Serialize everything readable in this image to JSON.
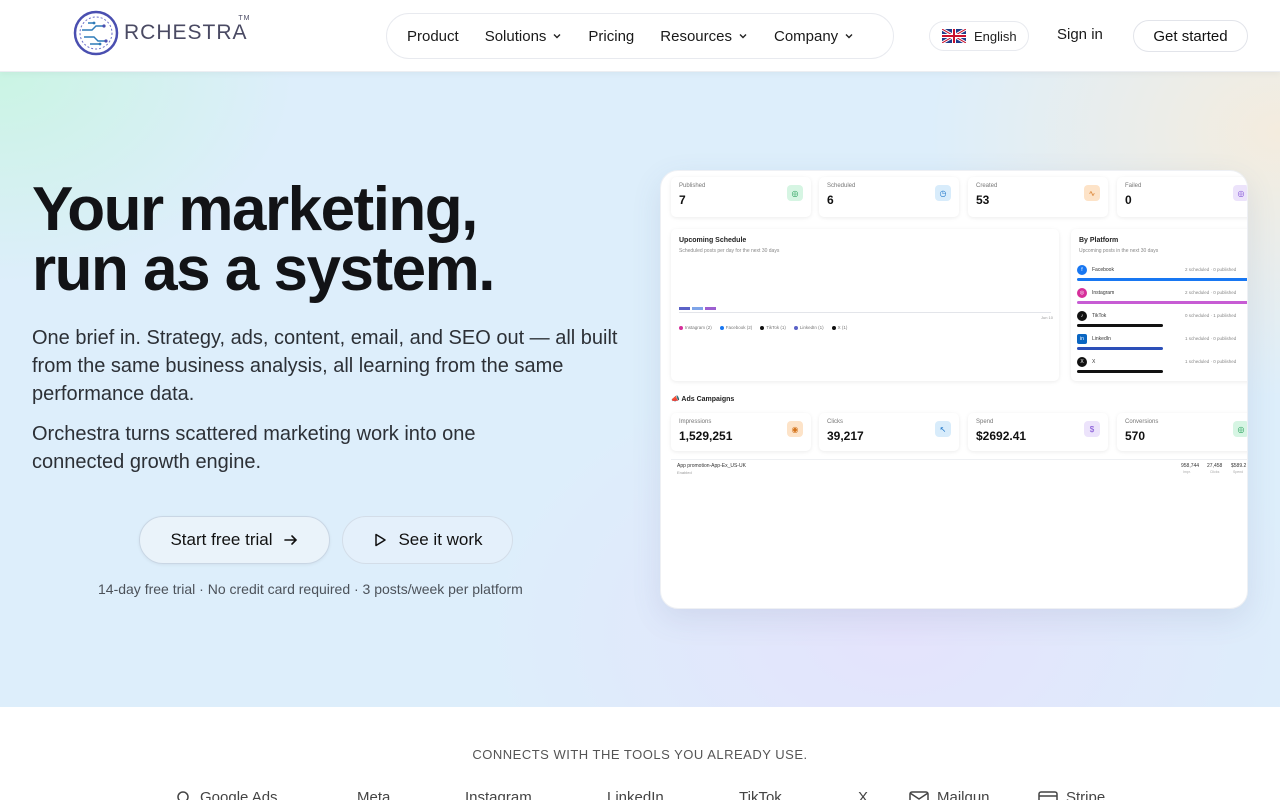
{
  "nav": {
    "logo_text": "RCHESTRA",
    "logo_tm": "TM",
    "menu": [
      {
        "label": "Product",
        "has_dropdown": false
      },
      {
        "label": "Solutions",
        "has_dropdown": true
      },
      {
        "label": "Pricing",
        "has_dropdown": false
      },
      {
        "label": "Resources",
        "has_dropdown": true
      },
      {
        "label": "Company",
        "has_dropdown": true
      }
    ],
    "language": "English",
    "signin": "Sign in",
    "cta": "Get started"
  },
  "hero": {
    "headline_line1": "Your marketing,",
    "headline_line2": "run as a system.",
    "sub1": "One brief in. Strategy, ads, content, email, and SEO out — all built from the same business analysis, all learning from the same performance data.",
    "sub2": "Orchestra turns scattered marketing work into one connected growth engine.",
    "primary_cta": "Start free trial",
    "secondary_cta": "See it work",
    "fineprint": "14-day free trial · No credit card required · 3 posts/week per platform"
  },
  "dashboard": {
    "stats": [
      {
        "label": "Published",
        "value": "7",
        "color": "#d6f5e3"
      },
      {
        "label": "Scheduled",
        "value": "6",
        "color": "#d8ecfb"
      },
      {
        "label": "Created",
        "value": "53",
        "color": "#fde3c8"
      },
      {
        "label": "Failed",
        "value": "0",
        "color": "#ece3fb"
      }
    ],
    "schedule": {
      "title": "Upcoming Schedule",
      "subtitle": "Scheduled posts per day for the next 30 days",
      "legend": [
        "Instagram (2)",
        "Facebook (2)",
        "TikTok (1)",
        "LinkedIn (1)",
        "X (1)"
      ],
      "date_label": "Jun 10"
    },
    "by_platform": {
      "title": "By Platform",
      "subtitle": "Upcoming posts in the next 30 days",
      "items": [
        {
          "name": "Facebook",
          "status": "2 scheduled · 0 published",
          "color": "#1877f2"
        },
        {
          "name": "Instagram",
          "status": "2 scheduled · 0 published",
          "color": "#d62f9a"
        },
        {
          "name": "TikTok",
          "status": "0 scheduled · 1 published",
          "color": "#111111"
        },
        {
          "name": "LinkedIn",
          "status": "1 scheduled · 0 published",
          "color": "#0a66c2"
        },
        {
          "name": "X",
          "status": "1 scheduled · 0 published",
          "color": "#111111"
        }
      ]
    },
    "ads": {
      "title": "Ads Campaigns",
      "stats": [
        {
          "label": "Impressions",
          "value": "1,529,251",
          "color": "#fde3c8"
        },
        {
          "label": "Clicks",
          "value": "39,217",
          "color": "#d8ecfb"
        },
        {
          "label": "Spend",
          "value": "$2692.41",
          "color": "#ece3fb"
        },
        {
          "label": "Conversions",
          "value": "570",
          "color": "#d6f5e3"
        }
      ],
      "campaign_name": "App promotion-App-Ex_US-UK",
      "campaign_status": "Enabled",
      "campaign_metrics": [
        "958,744",
        "27,458",
        "$589.2"
      ],
      "campaign_metric_labels": [
        "Impr.",
        "Clicks",
        "Spend"
      ]
    }
  },
  "connects": {
    "title": "CONNECTS WITH THE TOOLS YOU ALREADY USE.",
    "tools": [
      "Google Ads",
      "Meta",
      "Instagram",
      "LinkedIn",
      "TikTok",
      "X",
      "Mailgun",
      "Stripe"
    ]
  }
}
